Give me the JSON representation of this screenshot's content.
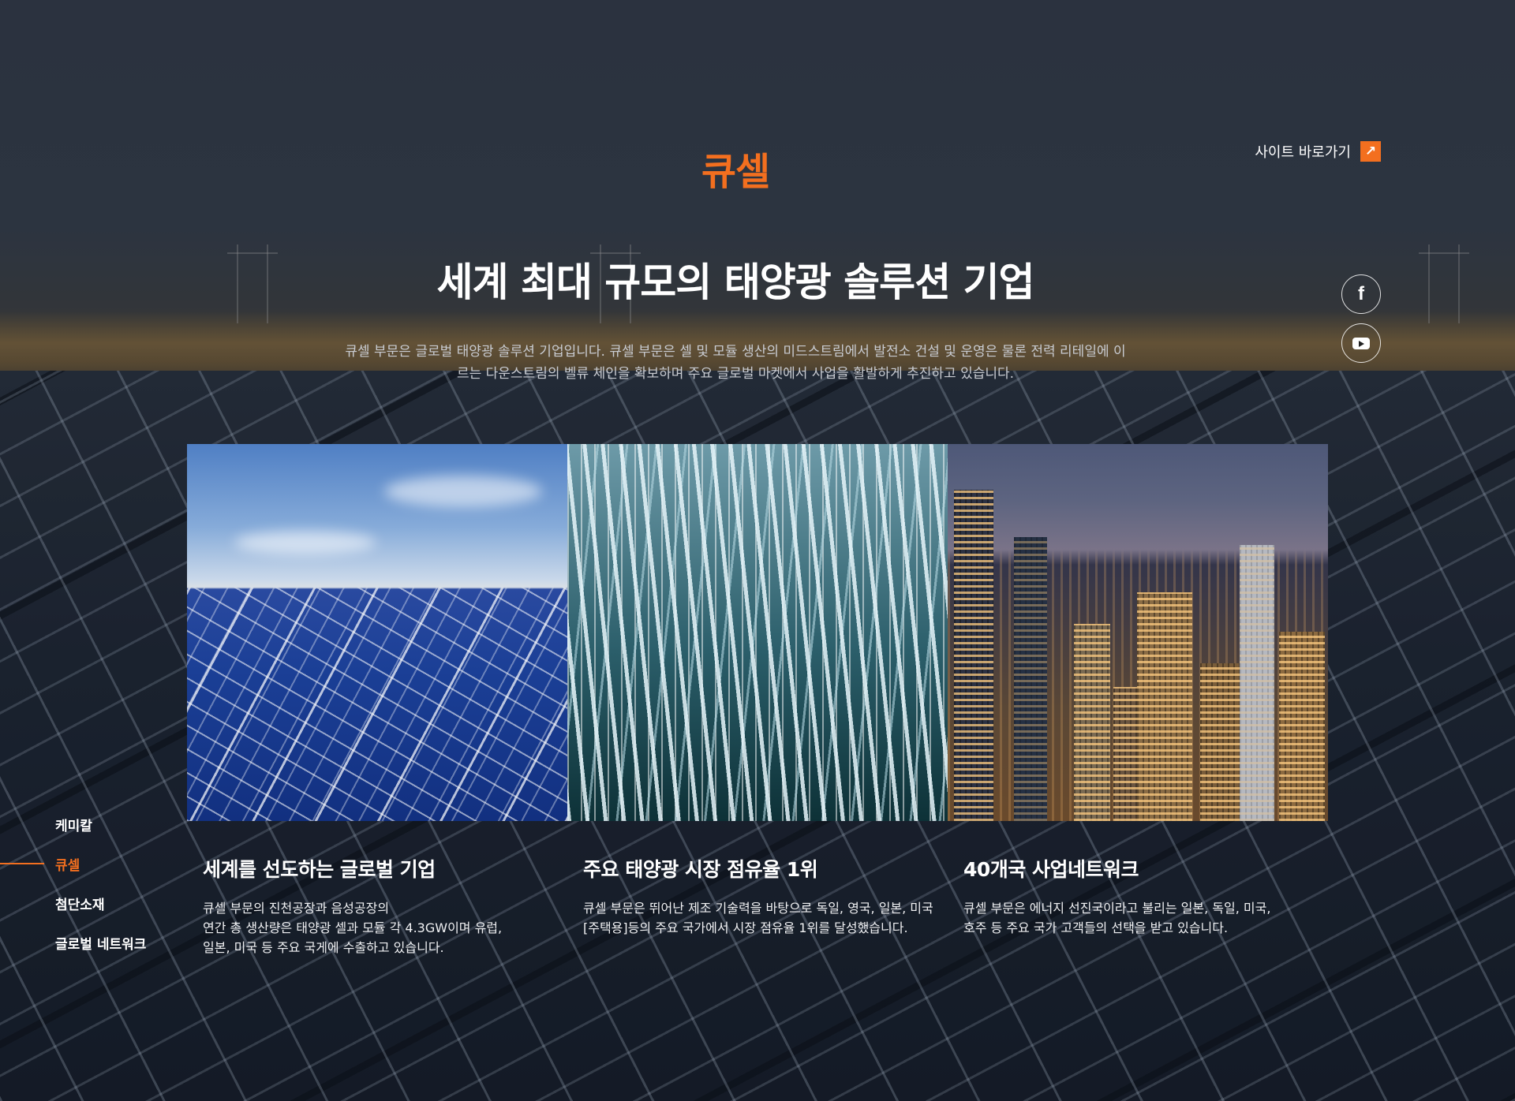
{
  "header": {
    "brand": "큐셀",
    "site_link_label": "사이트 바로가기",
    "site_link_icon": "arrow-up-right-icon"
  },
  "hero": {
    "headline": "세계 최대 규모의 태양광 솔루션 기업",
    "lead": "큐셀 부문은 글로벌 태양광 솔루션 기업입니다. 큐셀 부문은 셀 및 모듈 생산의 미드스트림에서 발전소 건설 및 운영은 물론 전력 리테일에 이르는 다운스트림의 벨류 체인을 확보하며 주요 글로벌 마켓에서 사업을 활발하게 추진하고 있습니다."
  },
  "social": {
    "facebook_glyph": "f",
    "facebook_icon": "facebook-icon",
    "youtube_icon": "youtube-icon"
  },
  "cards": [
    {
      "title": "세계를 선도하는 글로벌 기업",
      "desc": "큐셀 부문의 진천공장과 음성공장의\n연간 총 생산량은 태양광 셀과 모듈 각 4.3GW이며 유럽,\n일본, 미국 등 주요 국게에 수출하고 있습니다."
    },
    {
      "title": "주요 태양광 시장 점유율 1위",
      "desc": "큐셀 부문은 뛰어난 제조 기술력을 바탕으로 독일, 영국, 일본, 미국\n[주택용]등의 주요 국가에서 시장 점유율 1위를 달성했습니다."
    },
    {
      "title": "40개국 사업네트워크",
      "desc": "큐셀 부문은 에너지 선진국이라고 불리는 일본, 독일, 미국,\n호주 등 주요 국가 고객들의 선택을 받고 있습니다."
    }
  ],
  "sidenav": {
    "items": [
      {
        "label": "케미칼",
        "active": false
      },
      {
        "label": "큐셀",
        "active": true
      },
      {
        "label": "첨단소재",
        "active": false
      },
      {
        "label": "글로벌 네트워크",
        "active": false
      }
    ]
  },
  "colors": {
    "accent": "#f36f1f",
    "text": "#ffffff",
    "muted_text": "#c9ccd2"
  }
}
